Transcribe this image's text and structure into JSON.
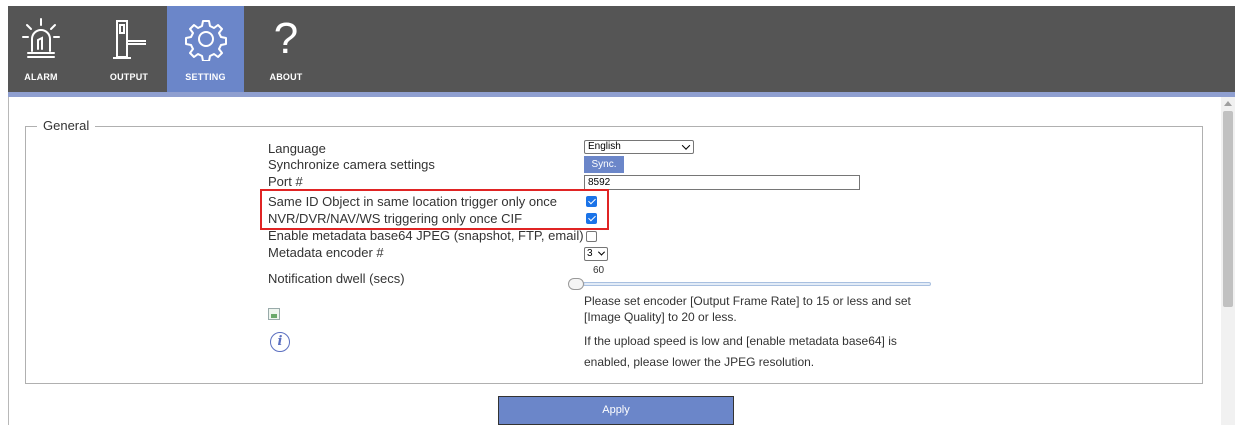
{
  "nav": {
    "items": [
      {
        "label": "ALARM",
        "icon": "alarm-light-icon"
      },
      {
        "label": "OUTPUT",
        "icon": "barrier-gate-icon"
      },
      {
        "label": "SETTING",
        "icon": "gear-icon",
        "active": true
      },
      {
        "label": "ABOUT",
        "icon": "question-mark-icon"
      }
    ],
    "about_glyph": "?"
  },
  "general": {
    "legend": "General",
    "labels": {
      "language": "Language",
      "sync": "Synchronize camera settings",
      "port": "Port #",
      "same_id": "Same ID Object in same location trigger only once",
      "nvr_once": "NVR/DVR/NAV/WS triggering only once CIF",
      "metadata_base64": "Enable metadata base64 JPEG (snapshot, FTP, email)",
      "metadata_encoder": "Metadata encoder #",
      "dwell": "Notification dwell (secs)"
    },
    "language_value": "English",
    "sync_button": "Sync.",
    "port_value": "8592",
    "same_id_checked": true,
    "nvr_once_checked": true,
    "metadata_base64_checked": false,
    "metadata_encoder_value": "3",
    "dwell_value": "60",
    "notes": {
      "line1": "Please set encoder [Output Frame Rate] to 15 or less and set",
      "line2": "[Image Quality] to 20 or less.",
      "line3": "If the upload speed is low and [enable metadata base64] is",
      "line4": "enabled, please lower the JPEG resolution."
    },
    "info_glyph": "i"
  },
  "apply_button": "Apply",
  "colors": {
    "topbar": "#555555",
    "accent": "#6b86c9",
    "highlight": "#e02424",
    "checkbox": "#1a73e8"
  }
}
